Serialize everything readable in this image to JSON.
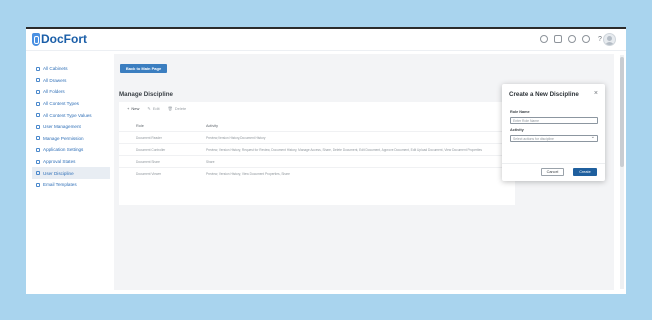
{
  "brand": {
    "name": "DocFort"
  },
  "topbar": {
    "icons": [
      "dashboard-icon",
      "bell-icon",
      "cloud-icon",
      "settings-icon",
      "help-icon"
    ],
    "help_glyph": "?"
  },
  "sidebar": {
    "items": [
      {
        "label": "All Cabinets",
        "icon": "cabinet-icon"
      },
      {
        "label": "All Drawers",
        "icon": "drawer-icon"
      },
      {
        "label": "All Folders",
        "icon": "folder-icon"
      },
      {
        "label": "All Content Types",
        "icon": "content-type-icon"
      },
      {
        "label": "All Content Type Values",
        "icon": "content-value-icon"
      },
      {
        "label": "User Management",
        "icon": "user-icon"
      },
      {
        "label": "Manage Permission",
        "icon": "permission-icon"
      },
      {
        "label": "Application Settings",
        "icon": "settings-icon"
      },
      {
        "label": "Approval States",
        "icon": "approval-icon"
      },
      {
        "label": "User Discipline",
        "icon": "discipline-icon",
        "active": true
      },
      {
        "label": "Email Templates",
        "icon": "email-icon"
      }
    ]
  },
  "main": {
    "back_button": "Back to Main Page",
    "title": "Manage Discipline",
    "actions": {
      "new": "New",
      "edit": "Edit",
      "delete": "Delete"
    },
    "columns": {
      "role": "Role",
      "activity": "Activity"
    },
    "rows": [
      {
        "role": "Document Reader",
        "activity": "Preview,Version History,Document History"
      },
      {
        "role": "Document Controller",
        "activity": "Preview, Version History, Request for Review, Document History, Manage Access, Share, Delete Document, Edit Document, Approve Document, Edit Upload Document, View Document Properties"
      },
      {
        "role": "Document Share",
        "activity": "Share"
      },
      {
        "role": "Document Viewer",
        "activity": "Preview, Version History, View Document Properties, Share"
      }
    ]
  },
  "modal": {
    "title": "Create a New Discipline",
    "close": "×",
    "role_label": "Role Name",
    "role_placeholder": "Enter Role Name",
    "activity_label": "Activity",
    "activity_placeholder": "Select actions for discipline",
    "cancel": "Cancel",
    "create": "Create"
  },
  "colors": {
    "accent": "#3b7ec0",
    "primary_button": "#1f5f9e",
    "link": "#2f6fb7"
  }
}
